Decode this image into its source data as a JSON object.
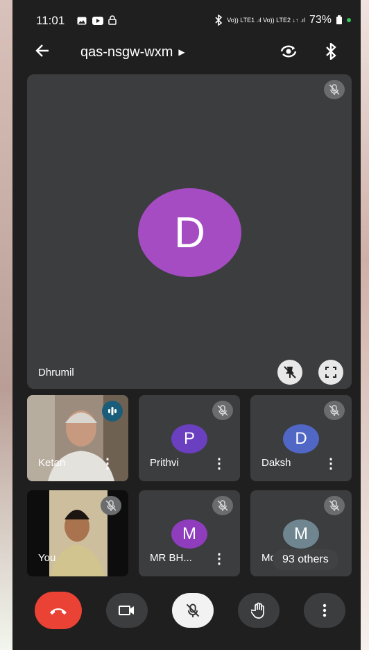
{
  "status_bar": {
    "time": "11:01",
    "notification_icons": [
      "gallery-icon",
      "youtube-icon",
      "lock-icon"
    ],
    "network_text": "Vo)) LTE1 .ıl Vo)) LTE2 ↓↑ .ıl",
    "battery_percent": "73%"
  },
  "header": {
    "meeting_code": "qas-nsgw-wxm"
  },
  "main_tile": {
    "name": "Dhrumil",
    "avatar_letter": "D",
    "avatar_color": "#a54cc3"
  },
  "participants": [
    {
      "name": "Ketan",
      "type": "video",
      "speaking": true
    },
    {
      "name": "Prithvi",
      "avatar_letter": "P",
      "avatar_color": "#6a3fc0",
      "muted": true
    },
    {
      "name": "Daksh",
      "avatar_letter": "D",
      "avatar_color": "#5067c6",
      "muted": true
    },
    {
      "name": "You",
      "type": "video",
      "muted": true
    },
    {
      "name": "MR BH...",
      "avatar_letter": "M",
      "avatar_color": "#8f3dbd",
      "muted": true
    },
    {
      "name": "Mo",
      "avatar_letter": "M",
      "avatar_color": "#6f8690",
      "muted": true
    }
  ],
  "others_label": "93 others",
  "controls": {
    "end_call_color": "#ea4335"
  }
}
